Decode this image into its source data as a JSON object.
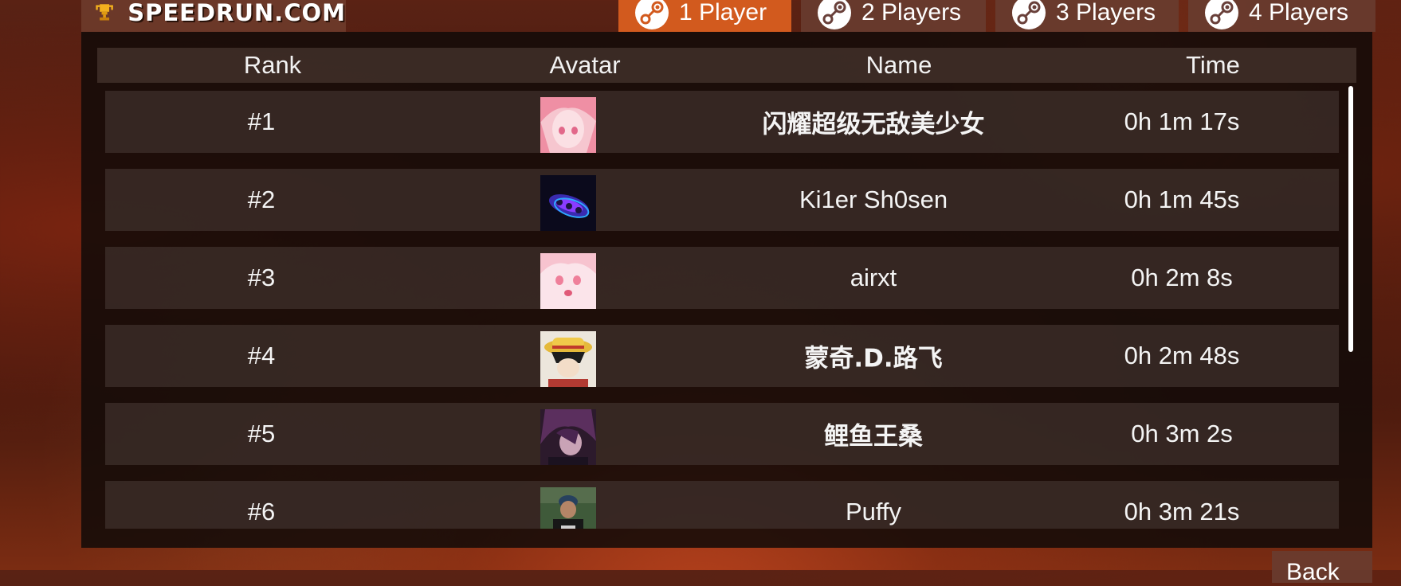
{
  "header": {
    "logo_text": "SPEEDRUN.COM",
    "tabs": [
      {
        "label": "1 Player",
        "active": true
      },
      {
        "label": "2 Players",
        "active": false
      },
      {
        "label": "3 Players",
        "active": false
      },
      {
        "label": "4 Players",
        "active": false
      }
    ]
  },
  "leaderboard": {
    "columns": {
      "rank": "Rank",
      "avatar": "Avatar",
      "name": "Name",
      "time": "Time"
    },
    "rows": [
      {
        "rank": "#1",
        "name": "闪耀超级无敌美少女",
        "time": "0h 1m 17s"
      },
      {
        "rank": "#2",
        "name": "Ki1er Sh0sen",
        "time": "0h 1m 45s"
      },
      {
        "rank": "#3",
        "name": "airxt",
        "time": "0h 2m 8s"
      },
      {
        "rank": "#4",
        "name": "蒙奇.D.路飞",
        "time": "0h 2m 48s"
      },
      {
        "rank": "#5",
        "name": "鲤鱼王桑",
        "time": "0h 3m 2s"
      },
      {
        "rank": "#6",
        "name": "Puffy",
        "time": "0h 3m 21s"
      }
    ]
  },
  "footer": {
    "back_label": "Back"
  },
  "colors": {
    "accent": "#d25a1e",
    "tab_inactive": "#69403a",
    "panel": "#120a08",
    "row": "#40322d"
  }
}
